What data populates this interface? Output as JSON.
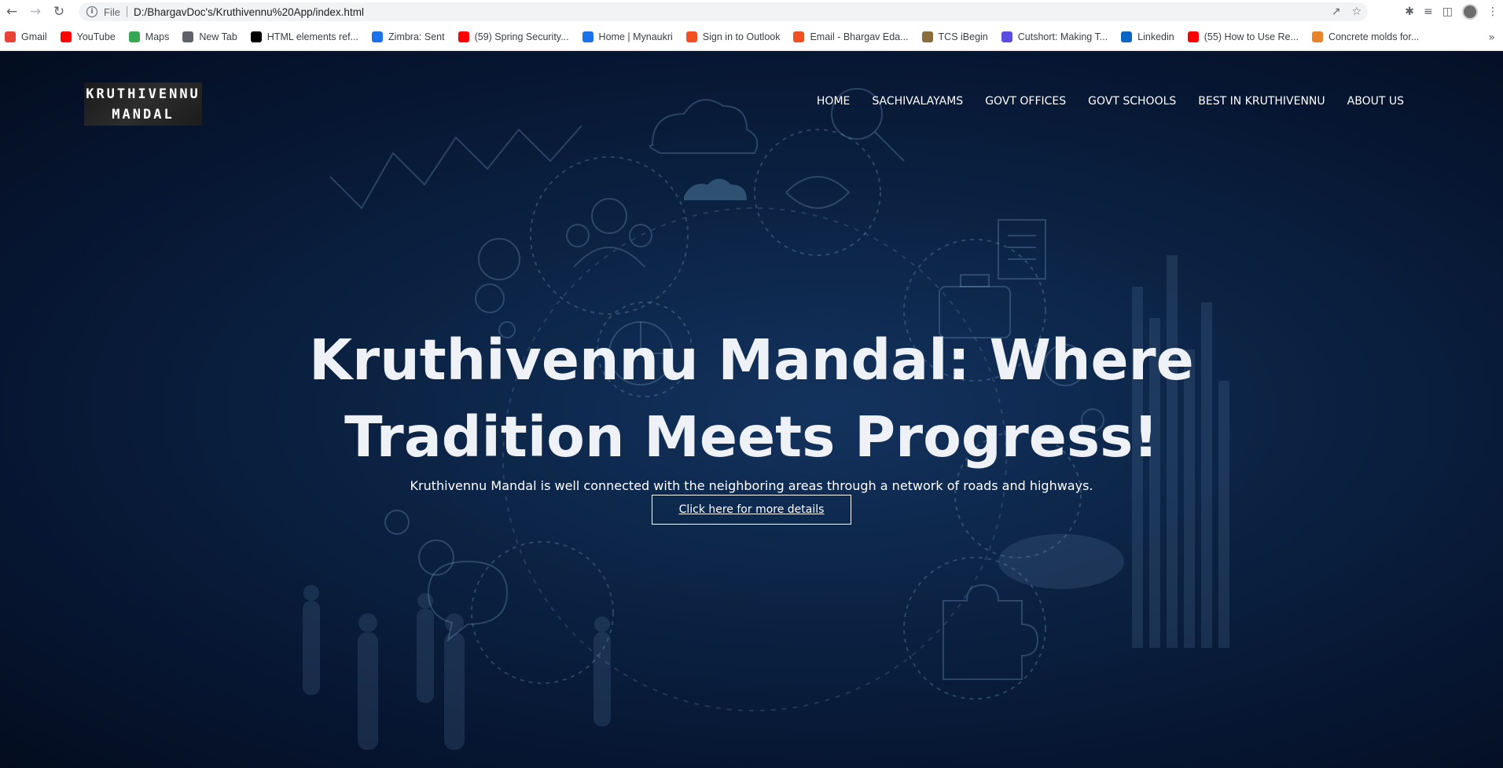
{
  "browser": {
    "scheme": "File",
    "url": "D:/BhargavDoc's/Kruthivennu%20App/index.html",
    "bookmarks": [
      {
        "label": "Gmail",
        "icon": "gmail-icon",
        "color": "#ea4335"
      },
      {
        "label": "YouTube",
        "icon": "youtube-icon",
        "color": "#ff0000"
      },
      {
        "label": "Maps",
        "icon": "maps-icon",
        "color": "#34a853"
      },
      {
        "label": "New Tab",
        "icon": "globe-icon",
        "color": "#5f6368"
      },
      {
        "label": "HTML elements ref...",
        "icon": "mdn-icon",
        "color": "#000000"
      },
      {
        "label": "Zimbra: Sent",
        "icon": "zimbra-icon",
        "color": "#1a73e8"
      },
      {
        "label": "(59) Spring Security...",
        "icon": "youtube-icon",
        "color": "#ff0000"
      },
      {
        "label": "Home | Mynaukri",
        "icon": "naukri-icon",
        "color": "#1a73e8"
      },
      {
        "label": "Sign in to Outlook",
        "icon": "microsoft-icon",
        "color": "#f25022"
      },
      {
        "label": "Email - Bhargav Eda...",
        "icon": "microsoft-icon",
        "color": "#f25022"
      },
      {
        "label": "TCS iBegin",
        "icon": "tcs-icon",
        "color": "#8a6d3b"
      },
      {
        "label": "Cutshort: Making T...",
        "icon": "cutshort-icon",
        "color": "#5b4de0"
      },
      {
        "label": "Linkedin",
        "icon": "linkedin-icon",
        "color": "#0a66c2"
      },
      {
        "label": "(55) How to Use Re...",
        "icon": "youtube-icon",
        "color": "#ff0000"
      },
      {
        "label": "Concrete molds for...",
        "icon": "amazon-icon",
        "color": "#e8832a"
      }
    ]
  },
  "site": {
    "logo_line1": "KRUTHIVENNU",
    "logo_line2": "MANDAL",
    "nav": [
      "HOME",
      "SACHIVALAYAMS",
      "GOVT OFFICES",
      "GOVT SCHOOLS",
      "BEST IN KRUTHIVENNU",
      "ABOUT US"
    ],
    "hero_title_line1": "Kruthivennu Mandal: Where",
    "hero_title_line2": "Tradition Meets Progress!",
    "hero_subtitle": "Kruthivennu Mandal is well connected with the neighboring areas through a network of roads and highways.",
    "cta_label": "Click here for more details"
  },
  "colors": {
    "page_background": "#071226",
    "hero_text": "#eef1f6"
  }
}
